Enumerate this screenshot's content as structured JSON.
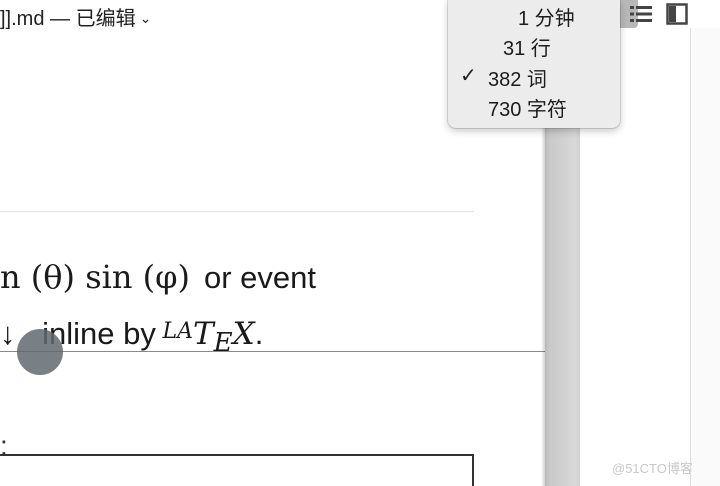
{
  "titlebar": {
    "title": "]].md — 已编辑",
    "chevron": "⌄",
    "icons": [
      "list-icon",
      "sidebar-toggle-icon"
    ]
  },
  "stats_menu": {
    "items": [
      {
        "label": "1 分钟",
        "checked": false
      },
      {
        "label": "31 行",
        "checked": false
      },
      {
        "label": "382 词",
        "checked": true
      },
      {
        "label": "730 字符",
        "checked": false
      }
    ],
    "check_glyph": "✓"
  },
  "editor": {
    "line1_math_a": "n (θ) sin (φ)",
    "line1_text": "or event",
    "line2_arrow": "↓",
    "line2_text": "inline by ",
    "line2_latex_la": "LA",
    "line2_latex_t": "T",
    "line2_latex_e": "E",
    "line2_latex_x": "X",
    "line2_period": ".",
    "line3_text": ":"
  },
  "watermark": "@51CTO博客"
}
